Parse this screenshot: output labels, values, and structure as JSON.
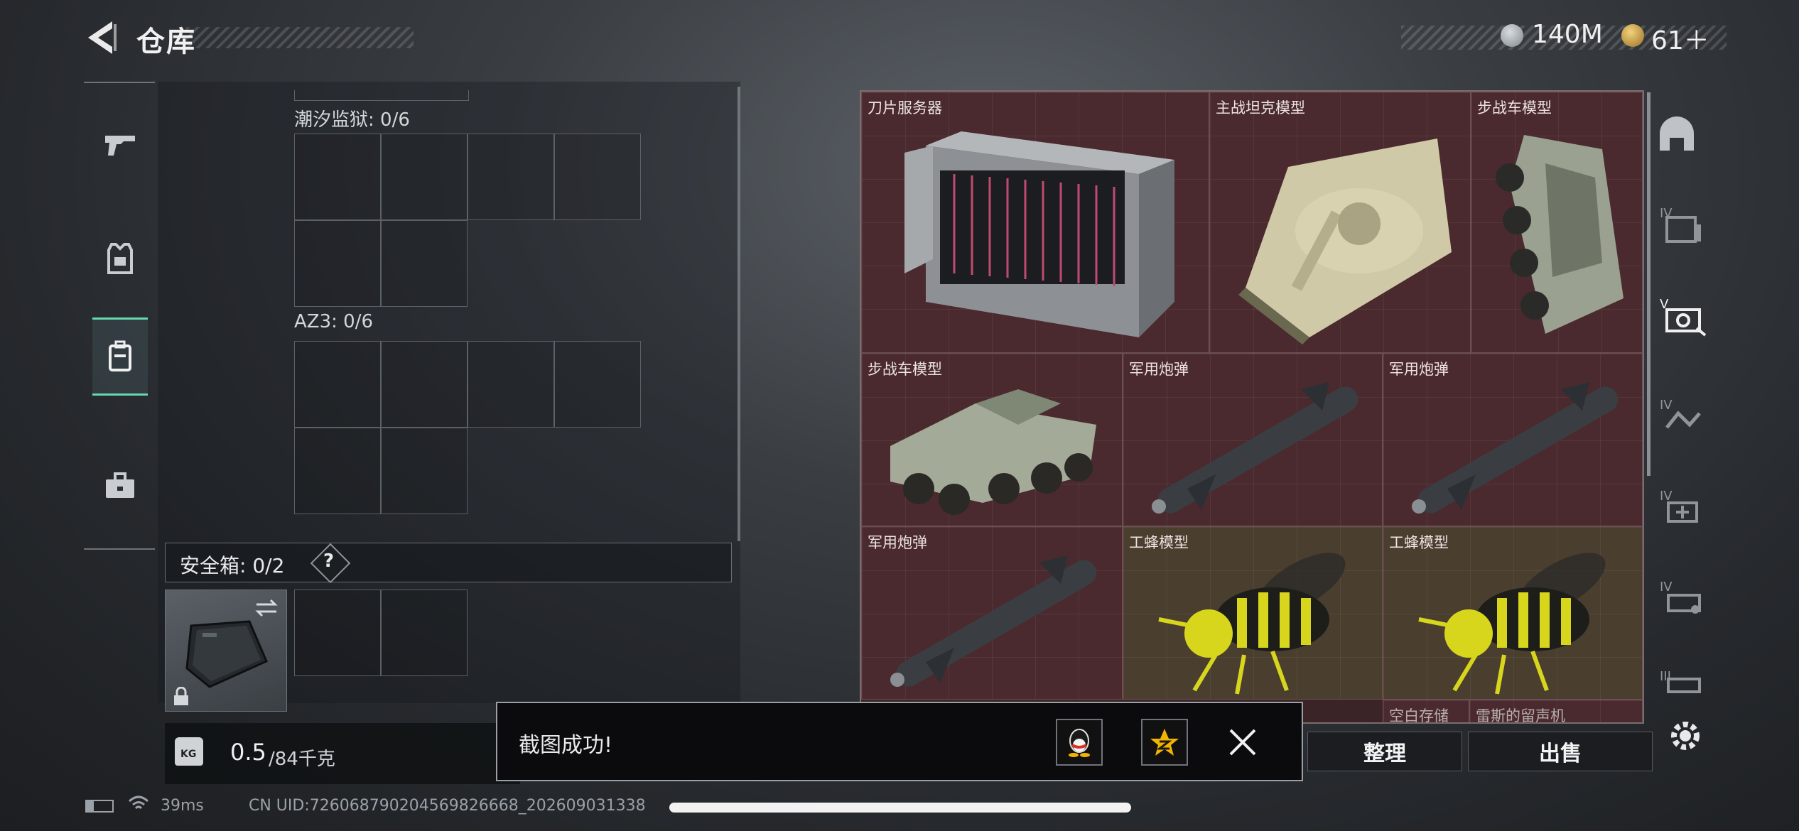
{
  "header": {
    "title": "仓库",
    "currency1": "140M",
    "currency2": "61＋"
  },
  "left": {
    "section1_label": "潮汐监狱: 0/6",
    "section2_label": "AZ3: 0/6",
    "safebox_label": "安全箱: 0/2",
    "safebox_help": "?",
    "weight_value": "0.5",
    "weight_max": "/84千克",
    "weight_icon_text": "KG"
  },
  "items": [
    {
      "name": "刀片服务器"
    },
    {
      "name": "主战坦克模型"
    },
    {
      "name": "步战车模型"
    },
    {
      "name": "步战车模型"
    },
    {
      "name": "军用炮弹"
    },
    {
      "name": "军用炮弹"
    },
    {
      "name": "军用炮弹"
    },
    {
      "name": "工蜂模型"
    },
    {
      "name": "工蜂模型"
    },
    {
      "name": "空白存储"
    },
    {
      "name": "雷斯的留声机"
    }
  ],
  "right_sidebar": {
    "tier_labels": [
      "IV",
      "V",
      "IV",
      "IV",
      "IV",
      "III"
    ]
  },
  "buttons": {
    "sort": "整理",
    "sell": "出售"
  },
  "toast": {
    "message": "截图成功!"
  },
  "status": {
    "ping": "39ms",
    "uid": "CN UID:726068790204569826668_202609031338"
  },
  "colors": {
    "accent": "#66d8b0",
    "item_red": "#4a2a2e",
    "item_gold": "#4a3e2f"
  }
}
